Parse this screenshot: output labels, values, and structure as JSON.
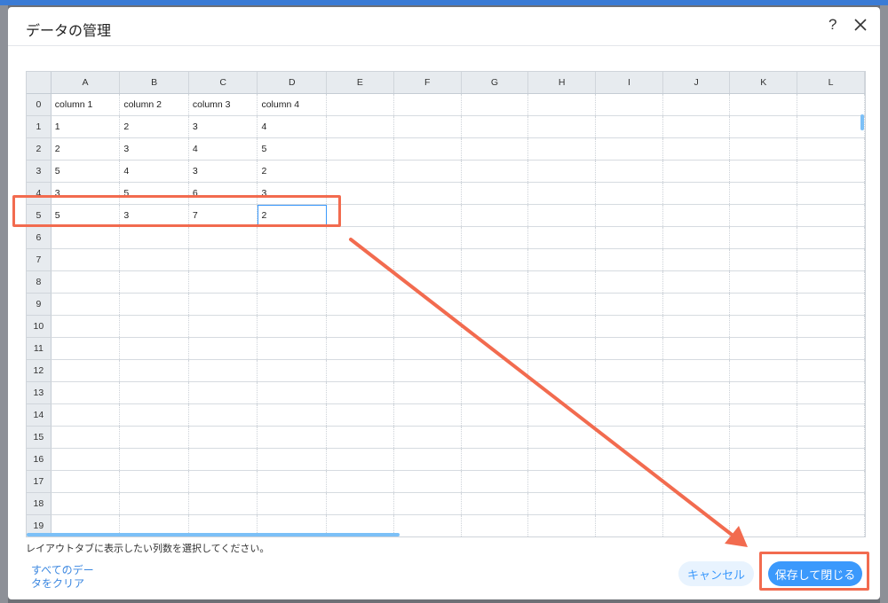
{
  "dialog": {
    "title": "データの管理",
    "help_icon": "question-mark-icon",
    "close_icon": "close-x-icon"
  },
  "grid": {
    "column_headers": [
      "A",
      "B",
      "C",
      "D",
      "E",
      "F",
      "G",
      "H",
      "I",
      "J",
      "K",
      "L"
    ],
    "row_headers": [
      "0",
      "1",
      "2",
      "3",
      "4",
      "5",
      "6",
      "7",
      "8",
      "9",
      "10",
      "11",
      "12",
      "13",
      "14",
      "15",
      "16",
      "17",
      "18",
      "19"
    ],
    "rows": [
      [
        "column 1",
        "column 2",
        "column 3",
        "column 4"
      ],
      [
        "1",
        "2",
        "3",
        "4"
      ],
      [
        "2",
        "3",
        "4",
        "5"
      ],
      [
        "5",
        "4",
        "3",
        "2"
      ],
      [
        "3",
        "5",
        "6",
        "3"
      ],
      [
        "5",
        "3",
        "7",
        "2"
      ]
    ],
    "selected_cell": {
      "row": 5,
      "col": 3
    }
  },
  "footer": {
    "hint": "レイアウトタブに表示したい列数を選択してください。",
    "clear_link": "すべてのデータをクリア",
    "cancel_label": "キャンセル",
    "save_label": "保存して閉じる"
  },
  "colors": {
    "accent": "#3b99fc",
    "annotation": "#f26b4f",
    "header_bg": "#e7ebef"
  }
}
